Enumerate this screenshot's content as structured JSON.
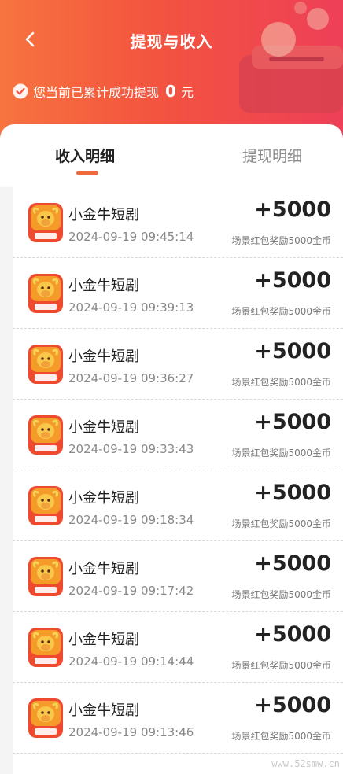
{
  "header": {
    "title": "提现与收入",
    "summary_prefix": "您当前已累计成功提现",
    "total_withdrawn": "0",
    "currency_unit": "元"
  },
  "tabs": [
    {
      "label": "收入明细",
      "active": true
    },
    {
      "label": "提现明细",
      "active": false
    }
  ],
  "records": [
    {
      "app": "小金牛短剧",
      "time": "2024-09-19 09:45:14",
      "amount": "+5000",
      "desc": "场景红包奖励5000金币"
    },
    {
      "app": "小金牛短剧",
      "time": "2024-09-19 09:39:13",
      "amount": "+5000",
      "desc": "场景红包奖励5000金币"
    },
    {
      "app": "小金牛短剧",
      "time": "2024-09-19 09:36:27",
      "amount": "+5000",
      "desc": "场景红包奖励5000金币"
    },
    {
      "app": "小金牛短剧",
      "time": "2024-09-19 09:33:43",
      "amount": "+5000",
      "desc": "场景红包奖励5000金币"
    },
    {
      "app": "小金牛短剧",
      "time": "2024-09-19 09:18:34",
      "amount": "+5000",
      "desc": "场景红包奖励5000金币"
    },
    {
      "app": "小金牛短剧",
      "time": "2024-09-19 09:17:42",
      "amount": "+5000",
      "desc": "场景红包奖励5000金币"
    },
    {
      "app": "小金牛短剧",
      "time": "2024-09-19 09:14:44",
      "amount": "+5000",
      "desc": "场景红包奖励5000金币"
    },
    {
      "app": "小金牛短剧",
      "time": "2024-09-19 09:13:46",
      "amount": "+5000",
      "desc": "场景红包奖励5000金币"
    }
  ],
  "icons": {
    "back": "chevron-left-icon",
    "check": "check-circle-icon",
    "app": "golden-bull-app-icon"
  },
  "colors": {
    "header_start": "#f7743f",
    "header_end": "#ee3f58",
    "tab_accent": "#ef6a3a"
  },
  "watermark": "www.52smw.cn"
}
